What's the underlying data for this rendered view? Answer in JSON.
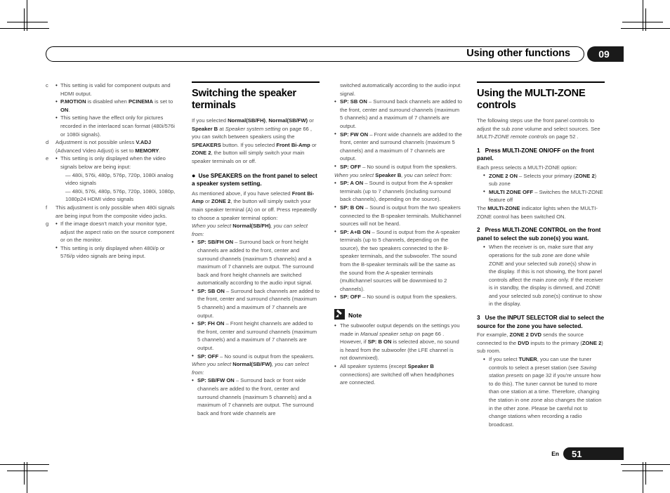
{
  "header": {
    "title": "Using other functions",
    "chapter": "09"
  },
  "footer": {
    "lang": "En",
    "page": "51"
  },
  "column1": {
    "items": [
      {
        "letter": "c",
        "bullets": [
          "This setting is valid for component outputs and HDMI output.",
          "P.MOTION is disabled when PCINEMA is set to ON.",
          "This setting have the effect only for pictures recorded in the interlaced scan format (480i/576i or 1080i signals)."
        ]
      },
      {
        "letter": "d",
        "text": "Adjustment is not possible unless V.ADJ (Advanced Video Adjust) is set to MEMORY."
      },
      {
        "letter": "e",
        "bullets": [
          "This setting is only displayed when the video signals below are being input:"
        ],
        "dashes": [
          "— 480i, 576i, 480p, 576p, 720p, 1080i analog video signals",
          "— 480i, 576i, 480p, 576p, 720p, 1080i, 1080p, 1080p24 HDMI video signals"
        ]
      },
      {
        "letter": "f",
        "text": "This adjustment is only possible when 480i signals are being input from the composite video jacks."
      },
      {
        "letter": "g",
        "bullets": [
          "If the image doesn't match your monitor type, adjust the aspect ratio on the source component or on the monitor.",
          "This setting is only displayed when 480i/p or 576i/p video signals are being input."
        ]
      }
    ]
  },
  "column2": {
    "section_title": "Switching the speaker terminals",
    "intro": "If you selected Normal(SB/FH), Normal(SB/FW) or Speaker B at Speaker system setting on page 66 , you can switch between speakers using the SPEAKERS button. If you selected Front Bi-Amp or ZONE 2, the button will simply switch your main speaker terminals on or off.",
    "sub_head": "Use SPEAKERS on the front panel to select a speaker system setting.",
    "body": "As mentioned above, if you have selected Front Bi-Amp or ZONE 2, the button will simply switch your main speaker terminal (A) on or off. Press repeatedly to choose a speaker terminal option:",
    "select_intro_fh": "When you select Normal(SB/FH), you can select from:",
    "bullets_fh": [
      "SP: SB/FH ON – Surround back or front height channels are added to the front, center and surround channels (maximum 5 channels) and a maximum of 7 channels are output. The surround back and front height channels are switched automatically according to the audio input signal.",
      "SP: SB ON – Surround back channels are added to the front, center and surround channels (maximum 5 channels) and a maximum of 7 channels are output.",
      "SP: FH ON – Front height channels are added to the front, center and surround channels (maximum 5 channels) and a maximum of 7 channels are output.",
      "SP: OFF – No sound is output from the speakers."
    ],
    "select_intro_fw": "When you select Normal(SB/FW), you can select from:",
    "bullets_fw_partial": "SP: SB/FW ON – Surround back or front wide channels are added to the front, center and surround channels (maximum 5 channels) and a maximum of 7 channels are output. The surround back and front wide channels are"
  },
  "column3": {
    "continued": "switched automatically according to the audio input signal.",
    "bullets_fw": [
      "SP: SB ON – Surround back channels are added to the front, center and surround channels (maximum 5 channels) and a maximum of 7 channels are output.",
      "SP: FW ON – Front wide channels are added to the front, center and surround channels (maximum 5 channels) and a maximum of 7 channels are output.",
      "SP: OFF – No sound is output from the speakers."
    ],
    "select_intro_b": "When you select Speaker B, you can select from:",
    "bullets_b": [
      "SP: A ON – Sound is output from the A-speaker terminals (up to 7 channels (including surround back channels), depending on the source).",
      "SP: B ON – Sound is output from the two speakers connected to the B-speaker terminals. Multichannel sources will not be heard.",
      "SP: A+B ON – Sound is output from the A-speaker terminals (up to 5 channels, depending on the source), the two speakers connected to the B-speaker terminals, and the subwoofer. The sound from the B-speaker terminals will be the same as the sound from the A-speaker terminals (multichannel sources will be downmixed to 2 channels).",
      "SP: OFF – No sound is output from the speakers."
    ],
    "note_label": "Note",
    "note_bullets": [
      "The subwoofer output depends on the settings you made in Manual speaker setup on page 66 . However, if SP: B ON is selected above, no sound is heard from the subwoofer (the LFE channel is not downmixed).",
      "All speaker systems (except Speaker B connections) are switched off when headphones are connected."
    ]
  },
  "column4": {
    "section_title": "Using the MULTI-ZONE controls",
    "intro": "The following steps use the front panel controls to adjust the sub zone volume and select sources. See MULTI-ZONE remote controls on page 52 .",
    "step1_num": "1",
    "step1": "Press MULTI-ZONE ON/OFF on the front panel.",
    "step1_body": "Each press selects a MULTI-ZONE option:",
    "step1_bullets": [
      "ZONE 2 ON – Selects your primary (ZONE 2) sub zone",
      "MULTI ZONE OFF – Switches the MULTI-ZONE feature off"
    ],
    "step1_after": "The MULTI-ZONE indicator lights when the MULTI-ZONE control has been switched ON.",
    "step2_num": "2",
    "step2": "Press MULTI-ZONE CONTROL on the front panel to select the sub zone(s) you want.",
    "step2_bullets": [
      "When the receiver is on, make sure that any operations for the sub zone are done while ZONE and your selected sub zone(s) show in the display. If this is not showing, the front panel controls affect the main zone only. If the receiver is in standby, the display is dimmed, and ZONE and your selected sub zone(s) continue to show in the display."
    ],
    "step3_num": "3",
    "step3": "Use the INPUT SELECTOR dial to select the source for the zone you have selected.",
    "step3_body": "For example, ZONE 2 DVD sends the source connected to the DVD inputs to the primary (ZONE 2) sub room.",
    "step3_bullets": [
      "If you select TUNER, you can use the tuner controls to select a preset station (see Saving station presets on page 32 if you're unsure how to do this). The tuner cannot be tuned to more than one station at a time. Therefore, changing the station in one zone also changes the station in the other zone. Please be careful not to change stations when recording a radio broadcast."
    ]
  }
}
